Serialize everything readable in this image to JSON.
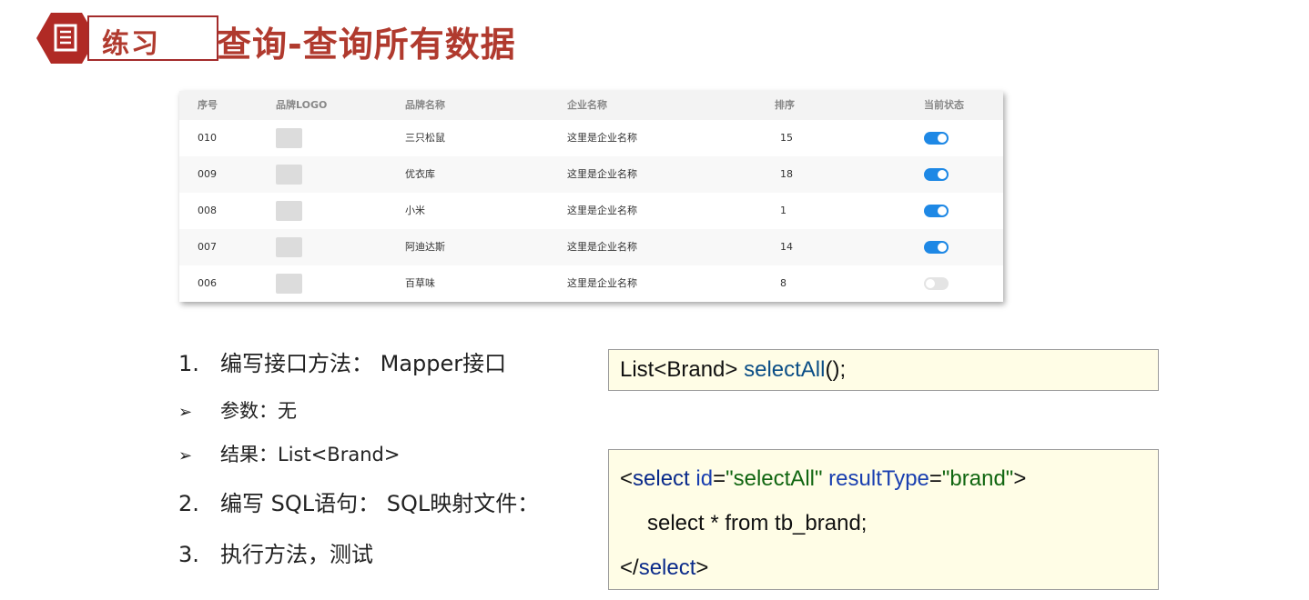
{
  "header": {
    "badge_label": "练习",
    "title": "查询-查询所有数据",
    "brand_color": "#b03a2e"
  },
  "table": {
    "columns": [
      "序号",
      "品牌LOGO",
      "品牌名称",
      "企业名称",
      "排序",
      "当前状态"
    ],
    "rows": [
      {
        "id": "010",
        "brand": "三只松鼠",
        "company": "这里是企业名称",
        "order": "15",
        "status_on": true
      },
      {
        "id": "009",
        "brand": "优衣库",
        "company": "这里是企业名称",
        "order": "18",
        "status_on": true
      },
      {
        "id": "008",
        "brand": "小米",
        "company": "这里是企业名称",
        "order": "1",
        "status_on": true
      },
      {
        "id": "007",
        "brand": "阿迪达斯",
        "company": "这里是企业名称",
        "order": "14",
        "status_on": true
      },
      {
        "id": "006",
        "brand": "百草味",
        "company": "这里是企业名称",
        "order": "8",
        "status_on": false
      }
    ]
  },
  "steps": {
    "s1_num": "1.",
    "s1_text": "编写接口方法： Mapper接口",
    "b1_bullet": "➢",
    "b1_text": "参数：无",
    "b2_bullet": "➢",
    "b2_text": "结果：List<Brand>",
    "s2_num": "2.",
    "s2_text": "编写 SQL语句： SQL映射文件：",
    "s3_num": "3.",
    "s3_text": "执行方法，测试"
  },
  "code_interface": {
    "type_part": "List<Brand> ",
    "method_part": "selectAll",
    "tail": "();"
  },
  "code_sql": {
    "open_lt": "<",
    "open_tag": "select",
    "attr_id": " id",
    "eq1": "=",
    "val_id": "\"selectAll\"",
    "attr_rt": " resultType",
    "eq2": "=",
    "val_rt": "\"brand\"",
    "open_gt": ">",
    "body": "select * from tb_brand;",
    "close_lt": "</",
    "close_tag": "select",
    "close_gt": ">"
  }
}
